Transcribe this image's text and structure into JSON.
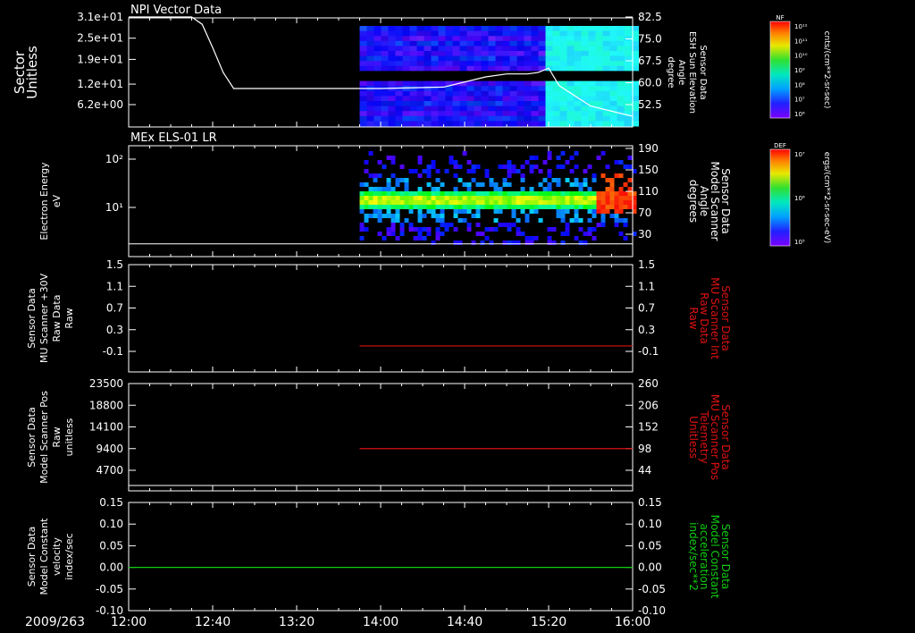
{
  "date_label": "2009/263",
  "time_ticks": [
    "12:00",
    "12:40",
    "13:20",
    "14:00",
    "14:40",
    "15:20",
    "16:00"
  ],
  "colors": {
    "background": "#000000",
    "axes": "#ffffff",
    "red_trace": "#dd1111",
    "green_trace": "#11cc11"
  },
  "panels": [
    {
      "title": "NPI Vector Data",
      "left_label": [
        "Sector",
        "Unitless"
      ],
      "left_ticks": [
        "3.1e+01",
        "2.5e+01",
        "1.9e+01",
        "1.2e+01",
        "6.2e+00"
      ],
      "right_label": [
        "Sensor Data",
        "ESH Sun Elevation",
        "Angle",
        "degree"
      ],
      "right_label_color": "#ffffff",
      "right_ticks": [
        "82.5",
        "75.0",
        "67.5",
        "60.0",
        "52.5"
      ],
      "colorbar": {
        "title": "NF",
        "ticks": [
          "10¹²",
          "10¹¹",
          "10¹⁰",
          "10⁹",
          "10⁸",
          "10⁷",
          "10⁶"
        ],
        "units": "cnts/(cm**2-sr-sec)"
      }
    },
    {
      "title": "MEx ELS-01 LR",
      "left_label": [
        "Electron Energy",
        "eV"
      ],
      "left_ticks": [
        "10²",
        "10¹"
      ],
      "right_label": [
        "Sensor Data",
        "Model Scanner",
        "Angle",
        "degrees"
      ],
      "right_label_color": "#ffffff",
      "right_ticks": [
        "190",
        "150",
        "110",
        "70",
        "30"
      ],
      "colorbar": {
        "title": "DEF",
        "ticks": [
          "10⁷",
          "10⁶",
          "10⁵"
        ],
        "units": "ergs/(cm**2-sr-sec-eV)"
      }
    },
    {
      "title": "",
      "left_label": [
        "Sensor Data",
        "MU Scanner +30V",
        "Raw Data",
        "Raw"
      ],
      "left_ticks": [
        "1.5",
        "1.1",
        "0.7",
        "0.3",
        "-0.1"
      ],
      "right_label": [
        "Sensor Data",
        "MU Scanner Int",
        "Raw Data",
        "Raw"
      ],
      "right_label_color": "#dd1111",
      "right_ticks": [
        "1.5",
        "1.1",
        "0.7",
        "0.3",
        "-0.1"
      ]
    },
    {
      "title": "",
      "left_label": [
        "Sensor Data",
        "Model Scanner Pos",
        "Raw",
        "unitless"
      ],
      "left_ticks": [
        "23500",
        "18800",
        "14100",
        "9400",
        "4700"
      ],
      "right_label": [
        "Sensor Data",
        "MU Scanner Pos",
        "Telemetry",
        "Unitless"
      ],
      "right_label_color": "#dd1111",
      "right_ticks": [
        "260",
        "206",
        "152",
        "98",
        "44"
      ]
    },
    {
      "title": "",
      "left_label": [
        "Sensor Data",
        "Model Constant",
        "velocity",
        "index/sec"
      ],
      "left_ticks": [
        "0.15",
        "0.10",
        "0.05",
        "0.00",
        "-0.05",
        "-0.10"
      ],
      "right_label": [
        "Sensor Data",
        "Model Constant",
        "acceleration",
        "index/sec**2"
      ],
      "right_label_color": "#11cc11",
      "right_ticks": [
        "0.15",
        "0.10",
        "0.05",
        "0.00",
        "-0.05",
        "-0.10"
      ]
    }
  ],
  "chart_data": [
    {
      "type": "line",
      "title": "NPI Vector Data",
      "xlabel": "2009/263",
      "x_ticks": [
        "12:00",
        "12:40",
        "13:20",
        "14:00",
        "14:40",
        "15:20",
        "16:00"
      ],
      "ylabel": "Sector Unitless",
      "ylim": [
        0,
        31
      ],
      "y2label": "Sensor Data ESH Sun Elevation Angle degree",
      "y2lim": [
        46,
        82.5
      ],
      "heatmap_time_range": [
        "13:50",
        "16:00"
      ],
      "series": [
        {
          "name": "Sensor Data ESH Sun Elevation Angle degree",
          "axis": "right",
          "x": [
            "12:00",
            "12:30",
            "12:35",
            "12:40",
            "12:45",
            "12:50",
            "14:00",
            "14:30",
            "14:50",
            "15:00",
            "15:10",
            "15:15",
            "15:20",
            "15:25",
            "15:40",
            "16:00"
          ],
          "y": [
            82.5,
            82.5,
            80.0,
            72.0,
            63.5,
            58.0,
            58.0,
            58.5,
            62.0,
            63.0,
            63.0,
            63.5,
            65.0,
            59.0,
            52.0,
            48.5
          ]
        }
      ]
    },
    {
      "type": "heatmap",
      "title": "MEx ELS-01 LR",
      "xlabel": "2009/263",
      "x_ticks": [
        "12:00",
        "12:40",
        "13:20",
        "14:00",
        "14:40",
        "15:20",
        "16:00"
      ],
      "ylabel": "Electron Energy eV",
      "y_scale": "log",
      "y2label": "Sensor Data Model Scanner Angle degrees",
      "y2lim": [
        5,
        190
      ],
      "heatmap_time_range": [
        "13:50",
        "16:00"
      ],
      "series": [
        {
          "name": "Sensor Data Model Scanner Angle degrees",
          "axis": "right",
          "x": [
            "12:00",
            "16:00"
          ],
          "y": [
            12,
            12
          ]
        }
      ]
    },
    {
      "type": "line",
      "xlabel": "2009/263",
      "x_ticks": [
        "12:00",
        "12:40",
        "13:20",
        "14:00",
        "14:40",
        "15:20",
        "16:00"
      ],
      "ylabel": "Sensor Data MU Scanner +30V Raw Data Raw",
      "ylim": [
        -0.3,
        1.5
      ],
      "y2label": "Sensor Data MU Scanner Int Raw Data Raw",
      "y2lim": [
        -0.3,
        1.5
      ],
      "series": [
        {
          "name": "Sensor Data MU Scanner Int Raw Data Raw",
          "axis": "right",
          "color": "#dd1111",
          "x": [
            "13:50",
            "16:00"
          ],
          "y": [
            0.0,
            0.0
          ]
        }
      ]
    },
    {
      "type": "line",
      "xlabel": "2009/263",
      "x_ticks": [
        "12:00",
        "12:40",
        "13:20",
        "14:00",
        "14:40",
        "15:20",
        "16:00"
      ],
      "ylabel": "Sensor Data Model Scanner Pos Raw unitless",
      "ylim": [
        0,
        23500
      ],
      "y2label": "Sensor Data MU Scanner Pos Telemetry Unitless",
      "y2lim": [
        0,
        260
      ],
      "series": [
        {
          "name": "Sensor Data MU Scanner Pos Telemetry Unitless",
          "axis": "right",
          "color": "#dd1111",
          "x": [
            "13:50",
            "16:00"
          ],
          "y": [
            98,
            98
          ]
        },
        {
          "name": "Sensor Data Model Scanner Pos Raw unitless",
          "axis": "left",
          "color": "#ffffff",
          "x": [
            "12:00",
            "16:00"
          ],
          "y": [
            0,
            0
          ]
        }
      ]
    },
    {
      "type": "line",
      "xlabel": "2009/263",
      "x_ticks": [
        "12:00",
        "12:40",
        "13:20",
        "14:00",
        "14:40",
        "15:20",
        "16:00"
      ],
      "ylabel": "Sensor Data Model Constant velocity index/sec",
      "ylim": [
        -0.1,
        0.15
      ],
      "y2label": "Sensor Data Model Constant acceleration index/sec**2",
      "y2lim": [
        -0.1,
        0.15
      ],
      "series": [
        {
          "name": "Sensor Data Model Constant acceleration index/sec**2",
          "axis": "right",
          "color": "#11cc11",
          "x": [
            "12:00",
            "16:00"
          ],
          "y": [
            0.0,
            0.0
          ]
        }
      ]
    }
  ]
}
